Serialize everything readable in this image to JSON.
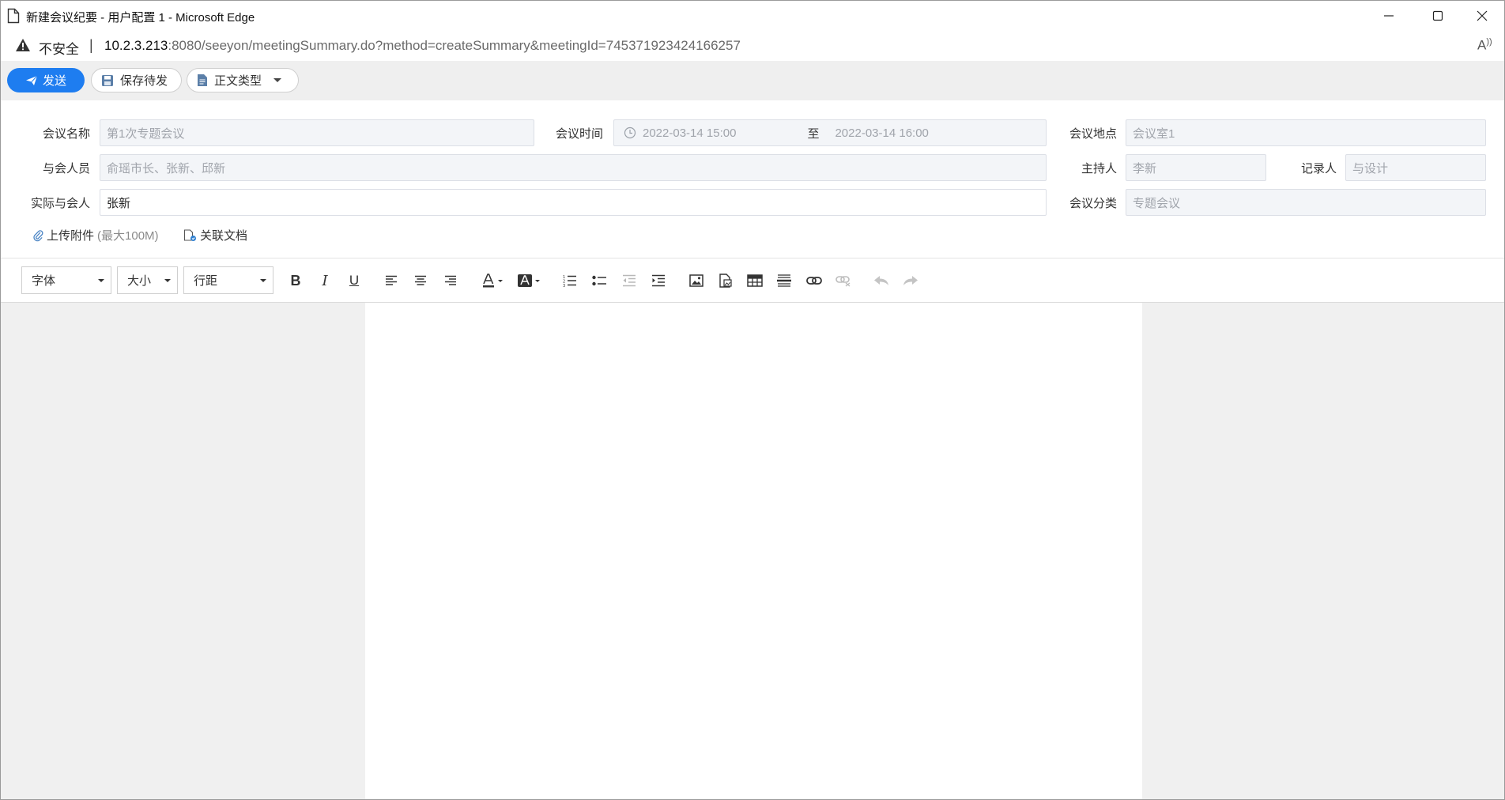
{
  "window": {
    "title": "新建会议纪要 - 用户配置 1 - Microsoft Edge"
  },
  "address": {
    "insecure_label": "不安全",
    "url_host": "10.2.3.213",
    "url_rest": ":8080/seeyon/meetingSummary.do?method=createSummary&meetingId=745371923424166257"
  },
  "actions": {
    "send": "发送",
    "save_draft": "保存待发",
    "body_type": "正文类型"
  },
  "form": {
    "meeting_name_label": "会议名称",
    "meeting_name_value": "第1次专题会议",
    "meeting_time_label": "会议时间",
    "time_start": "2022-03-14 15:00",
    "time_to": "至",
    "time_end": "2022-03-14 16:00",
    "location_label": "会议地点",
    "location_value": "会议室1",
    "attendees_label": "与会人员",
    "attendees_value": "俞瑶市长、张新、邱新",
    "host_label": "主持人",
    "host_value": "李新",
    "recorder_label": "记录人",
    "recorder_value": "与设计",
    "actual_attendees_label": "实际与会人",
    "actual_attendees_value": "张新",
    "category_label": "会议分类",
    "category_value": "专题会议",
    "upload_label": "上传附件",
    "upload_hint": "(最大100M)",
    "link_doc_label": "关联文档"
  },
  "editor": {
    "font_label": "字体",
    "size_label": "大小",
    "line_spacing_label": "行距"
  },
  "colors": {
    "accent": "#1e7df0",
    "field_bg": "#f3f5f8"
  }
}
